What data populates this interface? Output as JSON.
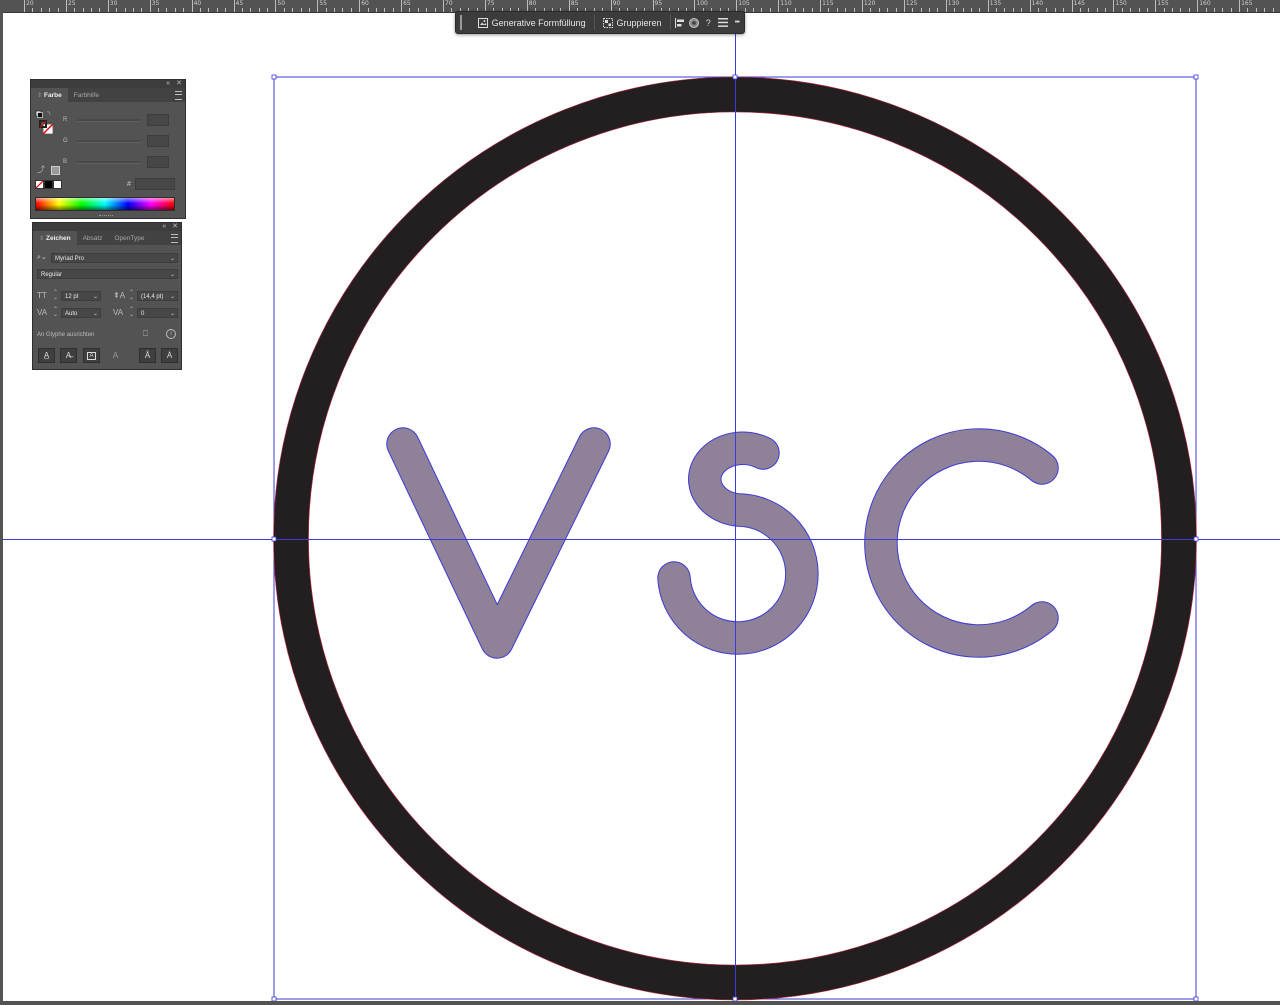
{
  "ruler": {
    "labels": [
      "20",
      "25",
      "30",
      "35",
      "40",
      "45",
      "50",
      "55",
      "60",
      "65",
      "70",
      "75",
      "80",
      "85",
      "90",
      "95",
      "100",
      "105",
      "110",
      "115",
      "120",
      "125",
      "130",
      "135",
      "140",
      "145",
      "150",
      "155",
      "160",
      "165"
    ]
  },
  "taskbar": {
    "generative_fill": "Generative Formfüllung",
    "group": "Gruppieren",
    "help": "?",
    "more": "•••"
  },
  "color_panel": {
    "tab_color": "Farbe",
    "tab_guide": "Farbhilfe",
    "slider_r": "R",
    "slider_g": "G",
    "slider_b": "B",
    "hex_symbol": "#"
  },
  "char_panel": {
    "tab_character": "Zeichen",
    "tab_paragraph": "Absatz",
    "tab_opentype": "OpenType",
    "font_family": "Myriad Pro",
    "font_style": "Regular",
    "font_size": "12 pt",
    "leading": "(14,4 pt)",
    "kerning": "Auto",
    "tracking": "0",
    "snap_glyph": "An Glyphe ausrichten"
  },
  "artwork": {
    "ring_color": "#231f20",
    "letter_fill": "#8f8198",
    "outline_color": "#3b3bd6",
    "letters": [
      "V",
      "S",
      "C"
    ]
  }
}
